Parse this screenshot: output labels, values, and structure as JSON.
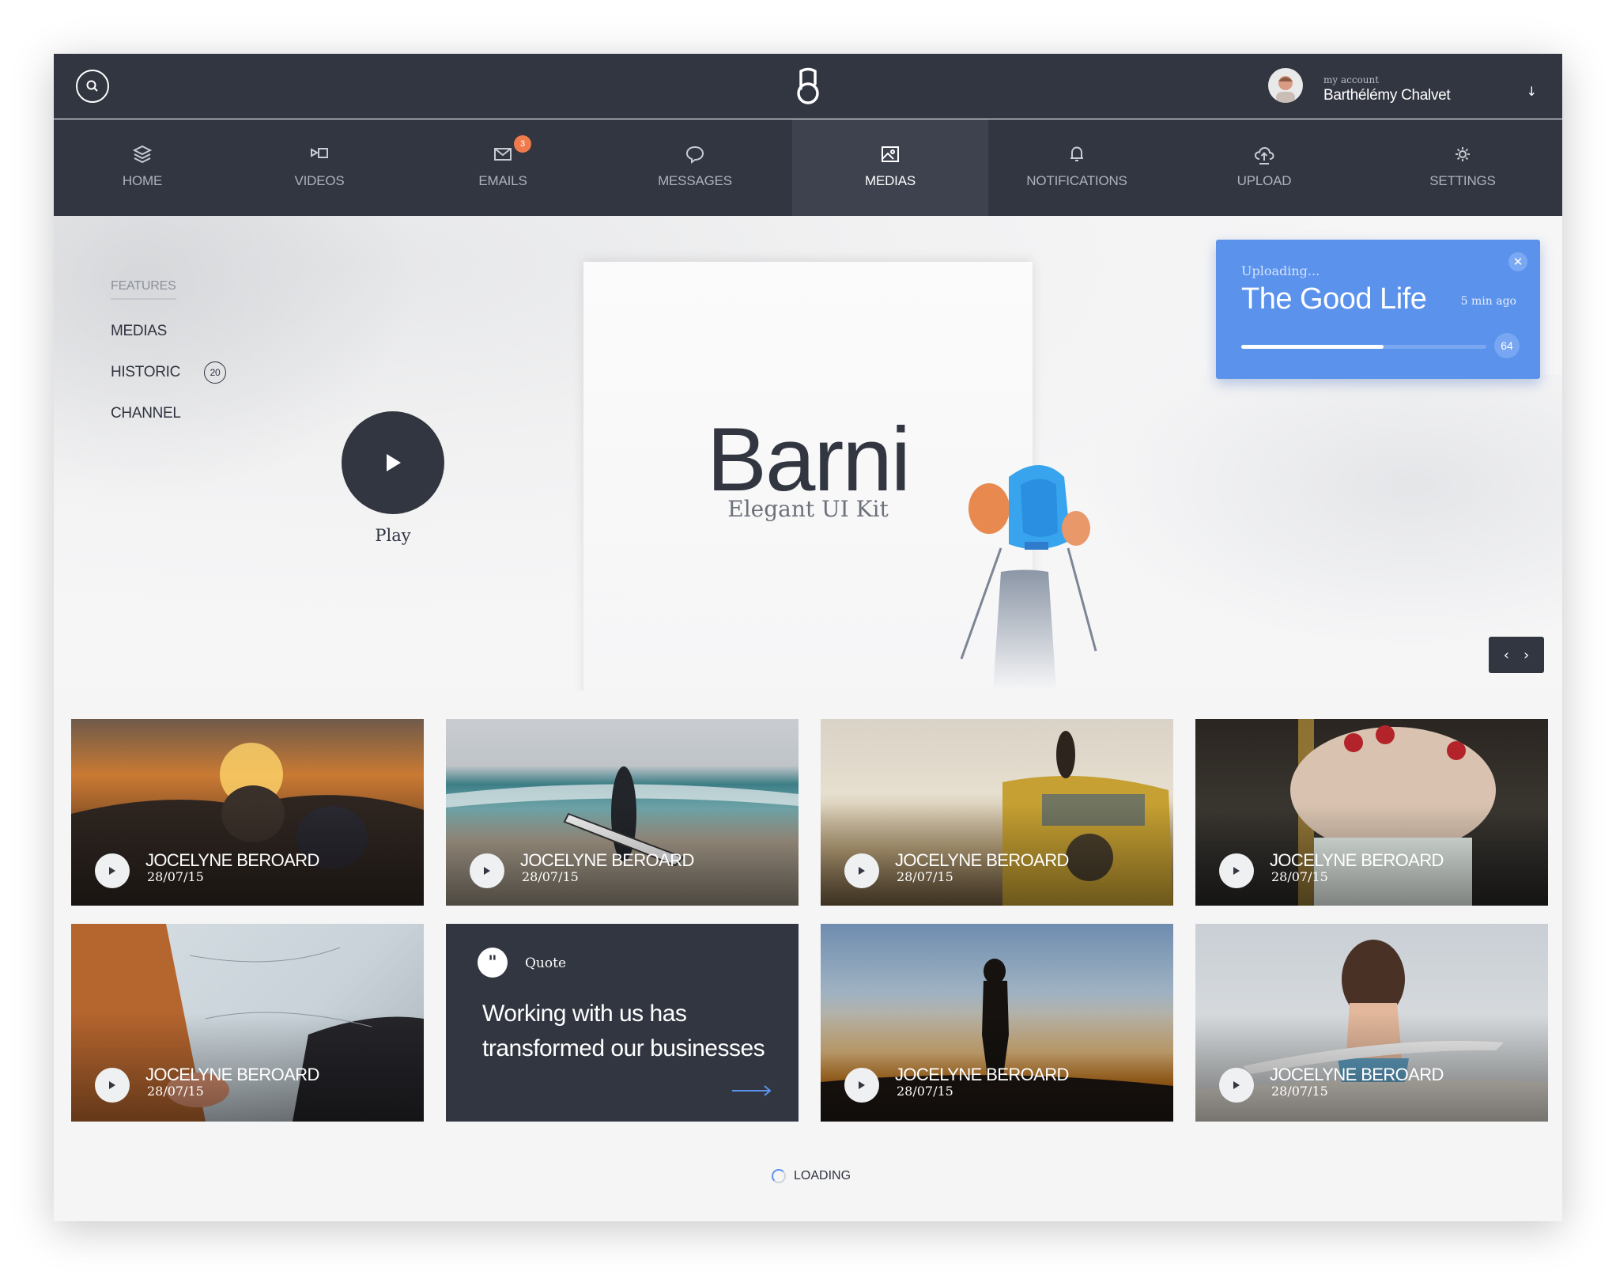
{
  "header": {
    "logo": "logo-mark",
    "account": {
      "caption": "my account",
      "name": "Barthélémy Chalvet"
    }
  },
  "nav": {
    "items": [
      {
        "label": "HOME",
        "icon": "layers-icon"
      },
      {
        "label": "VIDEOS",
        "icon": "video-icon"
      },
      {
        "label": "EMAILS",
        "icon": "mail-icon",
        "badge": "3"
      },
      {
        "label": "MESSAGES",
        "icon": "chat-bubble-icon"
      },
      {
        "label": "MEDIAS",
        "icon": "image-icon",
        "active": true
      },
      {
        "label": "NOTIFICATIONS",
        "icon": "bell-icon"
      },
      {
        "label": "UPLOAD",
        "icon": "cloud-upload-icon"
      },
      {
        "label": "SETTINGS",
        "icon": "gear-icon"
      }
    ]
  },
  "sidebar": {
    "heading": "FEATURES",
    "items": [
      {
        "label": "MEDIAS"
      },
      {
        "label": "HISTORIC",
        "badge": "20"
      },
      {
        "label": "CHANNEL"
      }
    ]
  },
  "hero": {
    "play_label": "Play",
    "title": "Barni",
    "subtitle": "Elegant UI Kit"
  },
  "upload": {
    "status": "Uploading...",
    "title": "The Good Life",
    "time": "5 min ago",
    "progress": 0.58,
    "count": "64"
  },
  "tiles": [
    {
      "name": "JOCELYNE BEROARD",
      "date": "28/07/15",
      "scene": "sunset-mountains"
    },
    {
      "name": "JOCELYNE BEROARD",
      "date": "28/07/15",
      "scene": "surfer-beach"
    },
    {
      "name": "JOCELYNE BEROARD",
      "date": "28/07/15",
      "scene": "yellow-van"
    },
    {
      "name": "JOCELYNE BEROARD",
      "date": "28/07/15",
      "scene": "dessert"
    },
    {
      "name": "JOCELYNE BEROARD",
      "date": "28/07/15",
      "scene": "map-bag"
    },
    {
      "name": "JOCELYNE BEROARD",
      "date": "28/07/15",
      "scene": "silhouette-sunset"
    },
    {
      "name": "JOCELYNE BEROARD",
      "date": "28/07/15",
      "scene": "surf-girl"
    }
  ],
  "quote": {
    "label": "Quote",
    "text": "Working with us has transformed our businesses"
  },
  "footer": {
    "loading": "LOADING"
  },
  "colors": {
    "dark": "#323641",
    "accent_blue": "#5b92ec",
    "badge_orange": "#ef7a4c"
  }
}
